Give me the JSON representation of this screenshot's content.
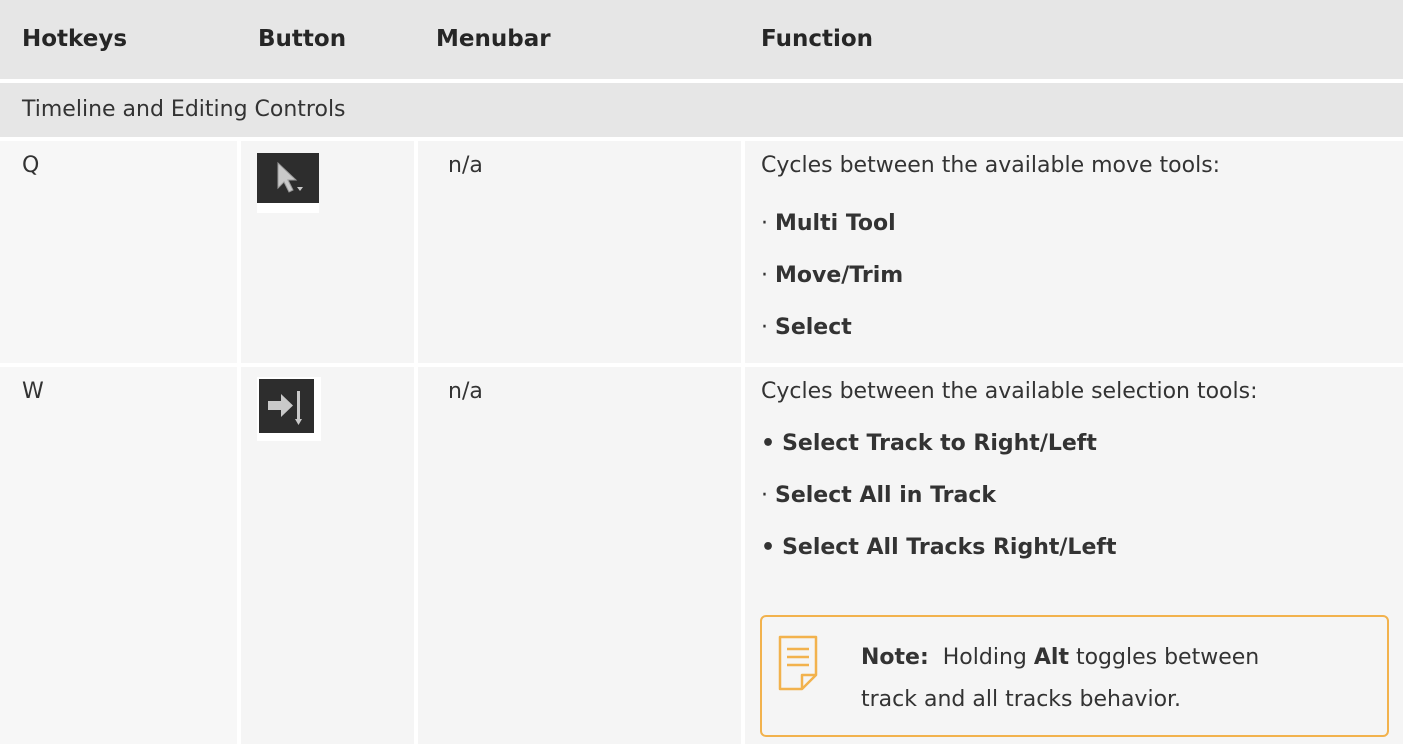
{
  "headers": {
    "hotkeys": "Hotkeys",
    "button": "Button",
    "menubar": "Menubar",
    "function": "Function"
  },
  "section": "Timeline and Editing Controls",
  "rows": [
    {
      "hotkey": "Q",
      "button_icon": "move-tool-cursor-icon",
      "menubar": "n/a",
      "description": "Cycles between the available move tools:",
      "items": [
        {
          "bullet": "·",
          "text": "Multi Tool"
        },
        {
          "bullet": "·",
          "text": "Move/Trim"
        },
        {
          "bullet": "·",
          "text": "Select"
        }
      ]
    },
    {
      "hotkey": "W",
      "button_icon": "select-track-arrow-icon",
      "menubar": "n/a",
      "description": "Cycles between the available selection tools:",
      "items": [
        {
          "bullet": "•",
          "text": "Select Track to Right/Left"
        },
        {
          "bullet": "·",
          "text": "Select All in Track"
        },
        {
          "bullet": "•",
          "text": "Select All Tracks Right/Left"
        }
      ],
      "note": {
        "label": "Note:",
        "text_before": "Holding",
        "key": "Alt",
        "text_after": "toggles between",
        "line2": "track and all tracks behavior."
      }
    }
  ],
  "colors": {
    "header_bg": "#e6e6e6",
    "cell_bg": "#f5f5f5",
    "note_border": "#f2b24d",
    "button_bg": "#2d2d2d"
  }
}
